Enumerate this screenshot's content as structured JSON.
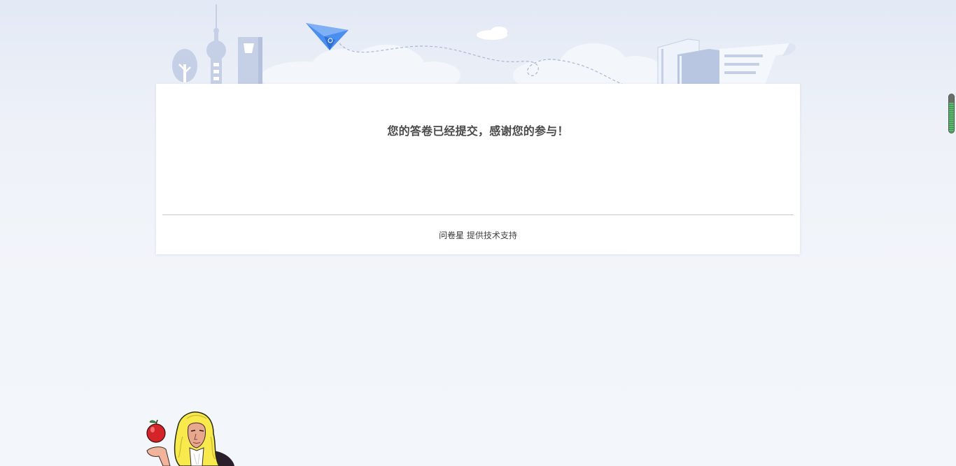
{
  "page": {
    "message": "您的答卷已经提交，感谢您的参与！",
    "footer": {
      "brand": "问卷星",
      "support_text": "提供技术支持"
    }
  },
  "icons": {
    "banner": "city-skyline-illustration",
    "plane": "paper-plane-icon",
    "mascot": "newton-apple-mascot",
    "scroll": "scroll-indicator"
  },
  "colors": {
    "background": "#f2f5fa",
    "card": "#ffffff",
    "text": "#4a4a4a",
    "plane": "#4a8fef"
  }
}
